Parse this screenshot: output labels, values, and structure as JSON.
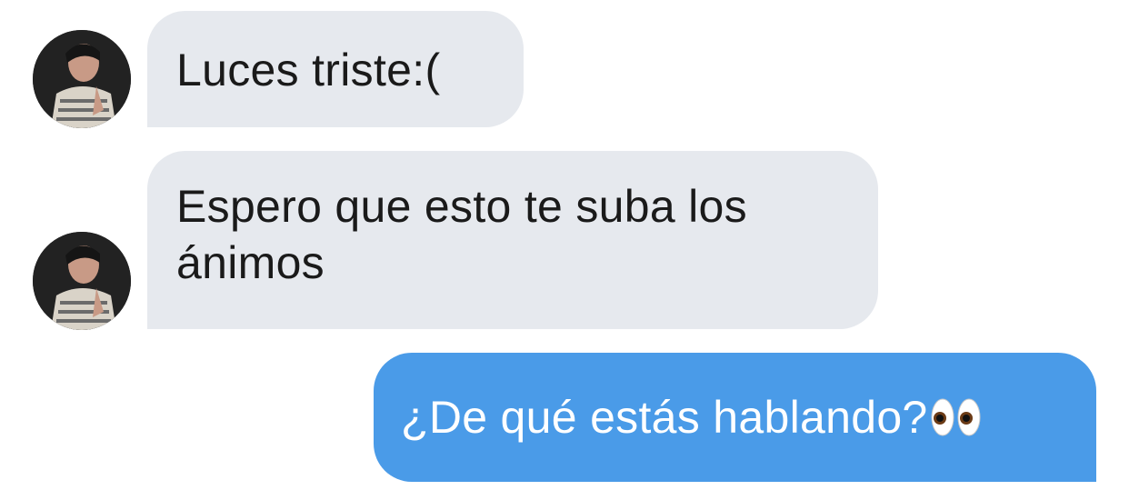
{
  "conversation": {
    "messages": [
      {
        "direction": "incoming",
        "text": "Luces triste:("
      },
      {
        "direction": "incoming",
        "text": "Espero que esto te suba los ánimos"
      },
      {
        "direction": "outgoing",
        "text": "¿De qué estás hablando?",
        "trailing_emoji": "eyes-emoji"
      }
    ]
  },
  "colors": {
    "incoming_bubble": "#e6e9ee",
    "outgoing_bubble": "#4a9be8",
    "incoming_text": "#1a1a1a",
    "outgoing_text": "#ffffff"
  }
}
